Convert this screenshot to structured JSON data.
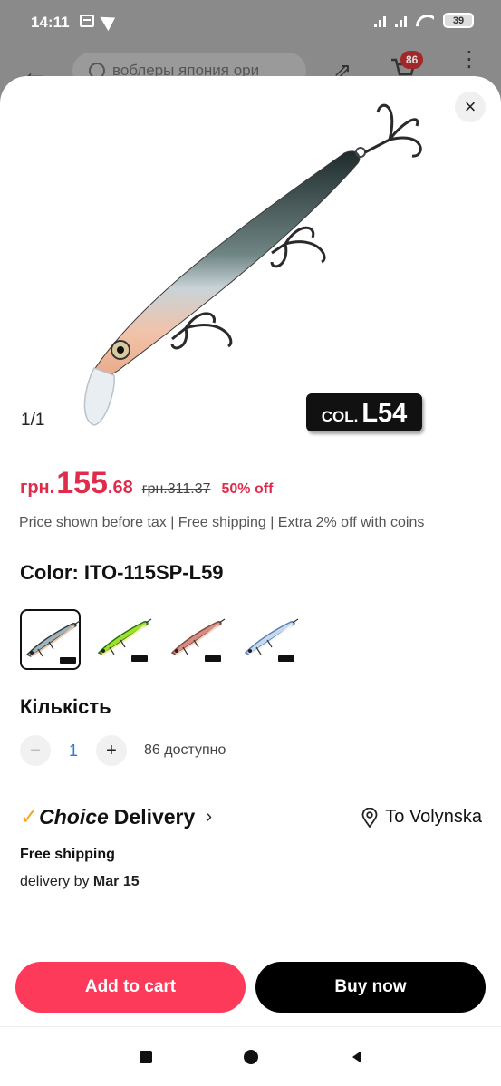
{
  "status_bar": {
    "time": "14:11",
    "battery": "39"
  },
  "background_header": {
    "search_text": "воблеры япония ори",
    "cart_count": "86"
  },
  "product": {
    "image_counter": "1/1",
    "badge_prefix": "COL.",
    "badge_code": "L54"
  },
  "price": {
    "currency": "грн.",
    "integer": "155",
    "decimal": ".68",
    "old": "грн.311.37",
    "discount": "50% off",
    "note": "Price shown before tax | Free shipping | Extra 2% off with coins"
  },
  "color": {
    "label": "Color:  ITO-115SP-L59",
    "options": [
      {
        "body": "#9fb2bd",
        "back": "#2d3b3a",
        "belly": "#f0c6a8",
        "selected": true
      },
      {
        "body": "#9be22a",
        "back": "#2a6e13",
        "belly": "#f5f0a0",
        "selected": false
      },
      {
        "body": "#d98a86",
        "back": "#7a4a3a",
        "belly": "#f2d6c6",
        "selected": false
      },
      {
        "body": "#c6d8ee",
        "back": "#5a7fb5",
        "belly": "#f5f5f8",
        "selected": false
      }
    ]
  },
  "quantity": {
    "title": "Кількість",
    "minus": "−",
    "value": "1",
    "plus": "+",
    "available": "86 доступно"
  },
  "delivery": {
    "check": "✓",
    "choice": "Choice",
    "label": "Delivery",
    "chevron": "›",
    "destination": "To Volynska",
    "free_shipping": "Free shipping",
    "by_prefix": "delivery by ",
    "by_date": "Mar 15"
  },
  "actions": {
    "add_to_cart": "Add to cart",
    "buy_now": "Buy now",
    "close": "×"
  },
  "colors": {
    "accent": "#fe3a5a",
    "price": "#e02c4a",
    "choice": "#f5a623"
  }
}
